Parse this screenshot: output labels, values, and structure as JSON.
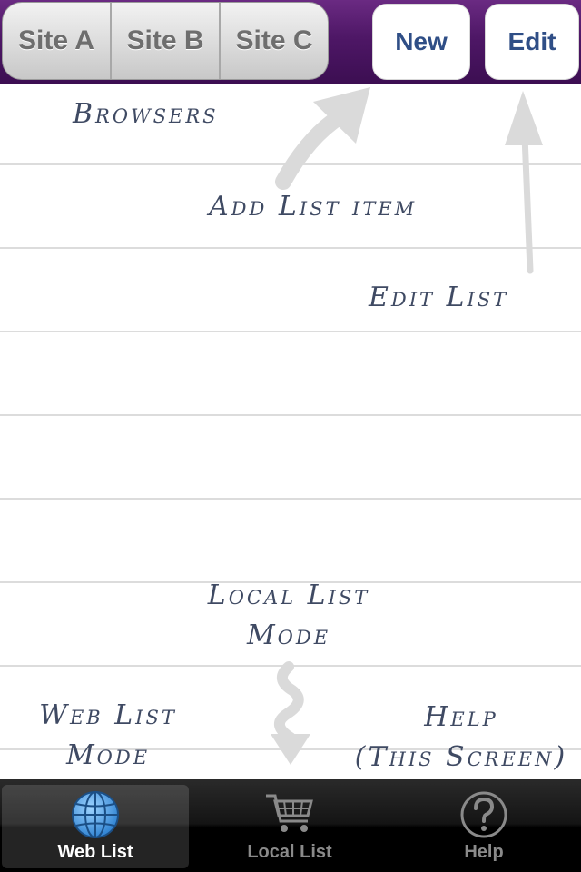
{
  "navbar": {
    "segments": [
      "Site A",
      "Site B",
      "Site C"
    ],
    "new_label": "New",
    "edit_label": "Edit"
  },
  "annotations": {
    "browsers": "Browsers",
    "add_list_item": "Add List item",
    "edit_list": "Edit List",
    "local_list_mode": [
      "Local List",
      "Mode"
    ],
    "web_list_mode": [
      "Web List",
      "Mode"
    ],
    "help": [
      "Help",
      "(This Screen)"
    ]
  },
  "tabbar": {
    "tabs": [
      {
        "label": "Web List",
        "icon": "globe-icon",
        "active": true
      },
      {
        "label": "Local List",
        "icon": "shopping-cart-icon",
        "active": false
      },
      {
        "label": "Help",
        "icon": "question-mark-icon",
        "active": false
      }
    ]
  },
  "colors": {
    "navbar": "#4e1766",
    "button_text": "#2f4e86",
    "annotation_text": "#3f4a63",
    "active_icon": "#4fa6e8"
  }
}
